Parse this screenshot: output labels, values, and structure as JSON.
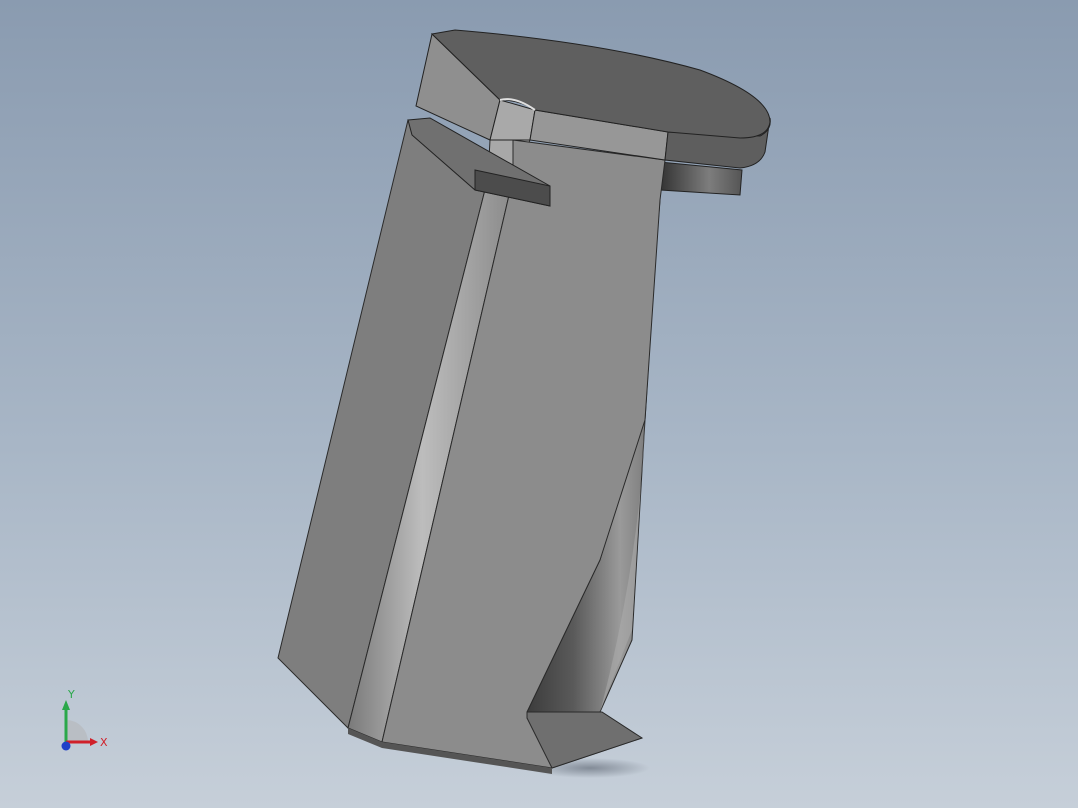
{
  "viewport": {
    "background_top": "#8a9bb0",
    "background_bottom": "#c6cfd9",
    "model": "grip-handle-part"
  },
  "triad": {
    "x_label": "X",
    "y_label": "Y",
    "colors": {
      "x": "#d0202a",
      "y": "#2aa84a",
      "z": "#2040c8"
    }
  }
}
